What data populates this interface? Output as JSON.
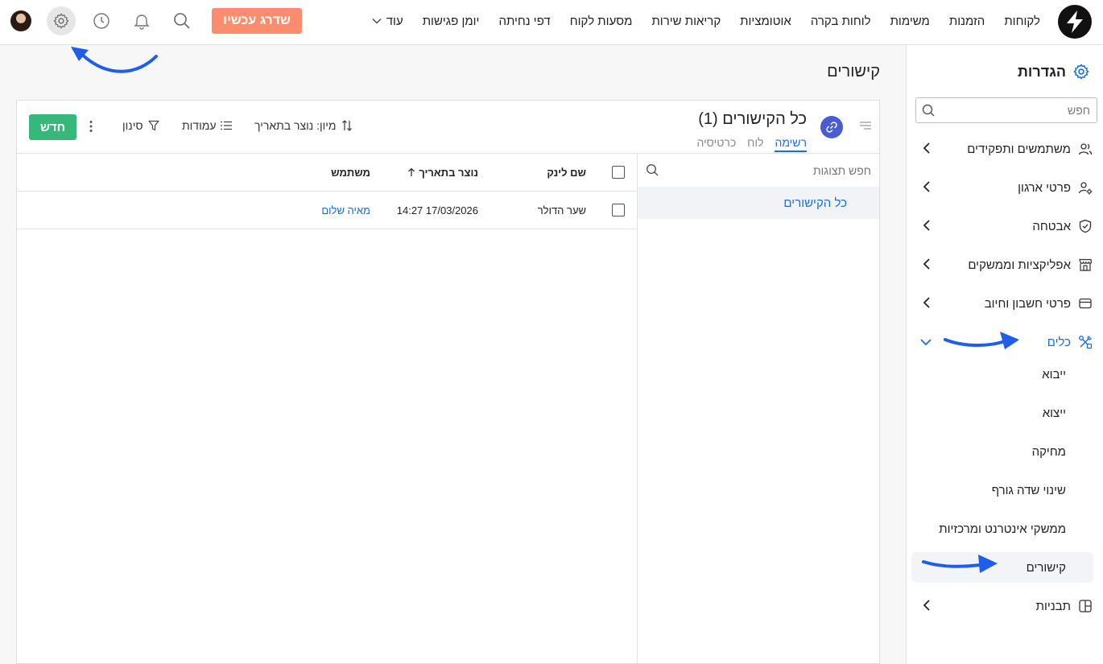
{
  "topbar": {
    "nav": [
      "לקוחות",
      "הזמנות",
      "משימות",
      "לוחות בקרה",
      "אוטומציות",
      "קריאות שירות",
      "מסעות לקוח",
      "דפי נחיתה",
      "יומן פגישות"
    ],
    "more_label": "עוד",
    "upgrade_label": "שדרג עכשיו"
  },
  "sidebar": {
    "title": "הגדרות",
    "search_placeholder": "חפש",
    "items": [
      {
        "label": "משתמשים ותפקידים",
        "icon": "users-icon"
      },
      {
        "label": "פרטי ארגון",
        "icon": "org-icon"
      },
      {
        "label": "אבטחה",
        "icon": "shield-icon"
      },
      {
        "label": "אפליקציות וממשקים",
        "icon": "store-icon"
      },
      {
        "label": "פרטי חשבון וחיוב",
        "icon": "credit-card-icon"
      },
      {
        "label": "כלים",
        "icon": "tools-icon"
      }
    ],
    "tools_sub": [
      "ייבוא",
      "ייצוא",
      "מחיקה",
      "שינוי שדה גורף",
      "ממשקי אינטרנט ומרכזיות",
      "קישורים"
    ],
    "templates_label": "תבניות"
  },
  "page": {
    "title": "קישורים"
  },
  "panel": {
    "view_title": "כל הקישורים (1)",
    "tabs": [
      "רשימה",
      "לוח",
      "כרטיסיה"
    ],
    "sort_label": "מיון: נוצר בתאריך",
    "columns_label": "עמודות",
    "filter_label": "סינון",
    "new_label": "חדש",
    "views_search_placeholder": "חפש תצוגות",
    "views": [
      "כל הקישורים"
    ]
  },
  "table": {
    "headers": {
      "link_name": "שם לינק",
      "created": "נוצר בתאריך",
      "user": "משתמש"
    },
    "rows": [
      {
        "link_name": "שער הדולר",
        "created": "17/03/2026 14:27",
        "user": "מאיה שלום"
      }
    ]
  },
  "colors": {
    "accent": "#1a6de0",
    "upgrade": "#fb8c6e",
    "new": "#36b87a",
    "link_badge": "#4a5ccf",
    "annotation": "#1f5ee8"
  }
}
